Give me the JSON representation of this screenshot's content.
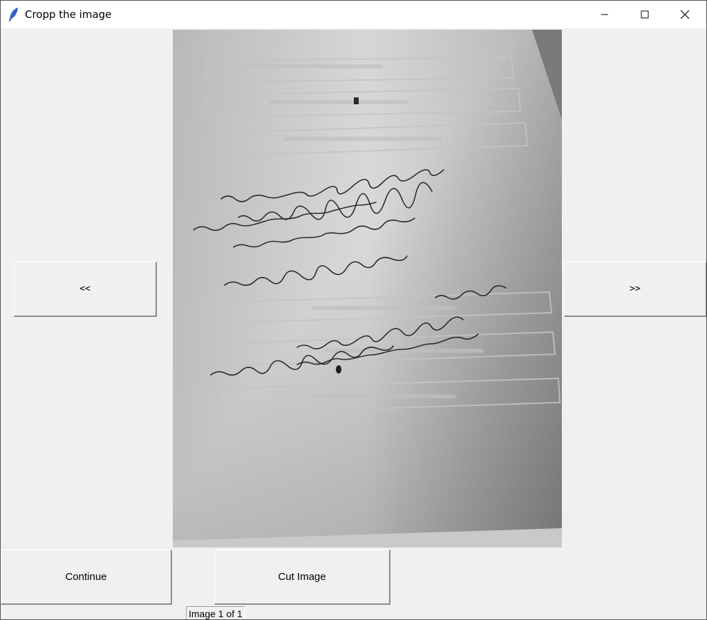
{
  "window": {
    "title": "Cropp the image",
    "app_icon": "feather-icon",
    "controls": [
      "minimize-icon",
      "maximize-icon",
      "close-icon"
    ]
  },
  "navigation": {
    "prev_label": "<<",
    "next_label": ">>"
  },
  "actions": {
    "continue_label": "Continue",
    "cut_label": "Cut Image"
  },
  "status": {
    "image_counter": "Image 1 of 1"
  },
  "image_content": {
    "handwritten_lines": [
      "ואיך שלא אפנה לראות תמיד אתה ארצה",
      "להיות, שומרת לי הגן אמונים לא מסתובבת",
      "בגנים. וגם אני בין הבריות לא מתפתה לאחרת.",
      "והוא היתה יפה קצת משונה וגם הכוכבים דולקים",
      "על אש קטנה.",
      "תשיר שיר לשלום אל תלחשו תפילה",
      "שלומית בונה סוכה מוארת ויפה על כן הוא עטופה"
    ]
  },
  "colors": {
    "window_bg": "#f0f0f0",
    "titlebar_bg": "#ffffff",
    "feather_icon": "#3b6fd8"
  }
}
